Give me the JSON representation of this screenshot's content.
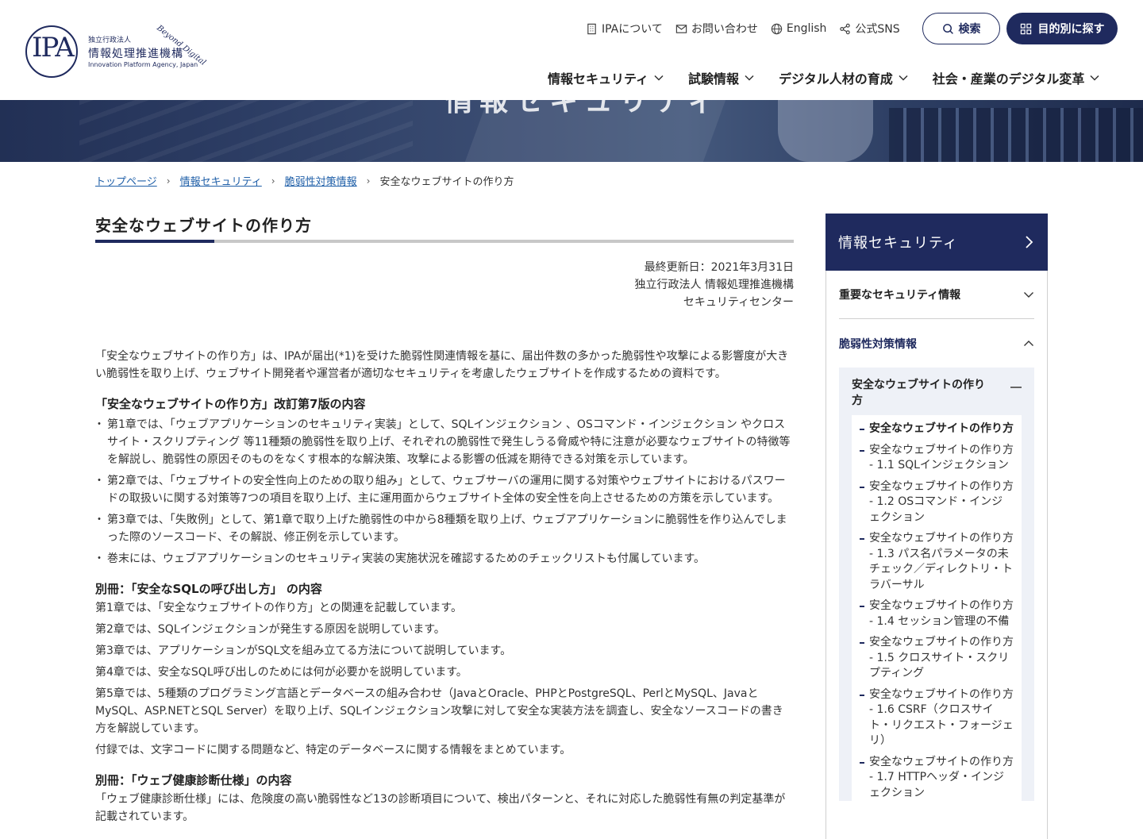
{
  "header": {
    "logo": {
      "ipa": "IPA",
      "small": "独立行政法人",
      "main": "情報処理推進機構",
      "en": "Innovation Platform Agency, Japan",
      "beyond": "Beyond Digital"
    },
    "util_nav": {
      "about": "IPAについて",
      "contact": "お問い合わせ",
      "english": "English",
      "sns": "公式SNS"
    },
    "search_label": "検索",
    "purpose_label": "目的別に探す",
    "main_nav": [
      "情報セキュリティ",
      "試験情報",
      "デジタル人材の育成",
      "社会・産業のデジタル変革"
    ]
  },
  "hero": {
    "title": "情報セキュリティ"
  },
  "breadcrumb": {
    "items": [
      "トップページ",
      "情報セキュリティ",
      "脆弱性対策情報"
    ],
    "current": "安全なウェブサイトの作り方"
  },
  "main": {
    "title": "安全なウェブサイトの作り方",
    "meta": {
      "updated": "最終更新日：2021年3月31日",
      "org": "独立行政法人 情報処理推進機構",
      "center": "セキュリティセンター"
    },
    "intro": "「安全なウェブサイトの作り方」は、IPAが届出(*1)を受けた脆弱性関連情報を基に、届出件数の多かった脆弱性や攻撃による影響度が大きい脆弱性を取り上げ、ウェブサイト開発者や運営者が適切なセキュリティを考慮したウェブサイトを作成するための資料です。",
    "sec1_title": "「安全なウェブサイトの作り方」改訂第7版の内容",
    "sec1_items": [
      "第1章では、「ウェブアプリケーションのセキュリティ実装」として、SQLインジェクション 、OSコマンド・インジェクション やクロスサイト・スクリプティング 等11種類の脆弱性を取り上げ、それぞれの脆弱性で発生しうる脅威や特に注意が必要なウェブサイトの特徴等を解説し、脆弱性の原因そのものをなくす根本的な解決策、攻撃による影響の低減を期待できる対策を示しています。",
      "第2章では、「ウェブサイトの安全性向上のための取り組み」として、ウェブサーバの運用に関する対策やウェブサイトにおけるパスワードの取扱いに関する対策等7つの項目を取り上げ、主に運用面からウェブサイト全体の安全性を向上させるための方策を示しています。",
      "第3章では、「失敗例」として、第1章で取り上げた脆弱性の中から8種類を取り上げ、ウェブアプリケーションに脆弱性を作り込んでしまった際のソースコード、その解説、修正例を示しています。",
      "巻末には、ウェブアプリケーションのセキュリティ実装の実施状況を確認するためのチェックリストも付属しています。"
    ],
    "sec2_title": "別冊：「安全なSQLの呼び出し方」 の内容",
    "sec2_paras": [
      "第1章では、「安全なウェブサイトの作り方」との関連を記載しています。",
      "第2章では、SQLインジェクションが発生する原因を説明しています。",
      "第3章では、アプリケーションがSQL文を組み立てる方法について説明しています。",
      "第4章では、安全なSQL呼び出しのためには何が必要かを説明しています。",
      "第5章では、5種類のプログラミング言語とデータベースの組み合わせ（JavaとOracle、PHPとPostgreSQL、PerlとMySQL、JavaとMySQL、ASP.NETとSQL Server）を取り上げ、SQLインジェクション攻撃に対して安全な実装方法を調査し、安全なソースコードの書き方を解説しています。",
      "付録では、文字コードに関する問題など、特定のデータベースに関する情報をまとめています。"
    ],
    "sec3_title": "別冊：「ウェブ健康診断仕様」の内容",
    "sec3_para": "「ウェブ健康診断仕様」には、危険度の高い脆弱性など13の診断項目について、検出パターンと、それに対応した脆弱性有無の判定基準が記載されています。"
  },
  "sidebar": {
    "title": "情報セキュリティ",
    "sections": [
      "重要なセキュリティ情報",
      "脆弱性対策情報"
    ],
    "sub_title": "安全なウェブサイトの作り方",
    "sub_items": [
      "安全なウェブサイトの作り方",
      "安全なウェブサイトの作り方 - 1.1 SQLインジェクション",
      "安全なウェブサイトの作り方 - 1.2 OSコマンド・インジェクション",
      "安全なウェブサイトの作り方 - 1.3 パス名パラメータの未チェック／ディレクトリ・トラバーサル",
      "安全なウェブサイトの作り方 - 1.4 セッション管理の不備",
      "安全なウェブサイトの作り方 - 1.5 クロスサイト・スクリプティング",
      "安全なウェブサイトの作り方 - 1.6 CSRF（クロスサイト・リクエスト・フォージェリ）",
      "安全なウェブサイトの作り方 - 1.7 HTTPヘッダ・インジェクション"
    ]
  },
  "colors": {
    "navy": "#1f2a5e",
    "link": "#1f5fa8"
  }
}
